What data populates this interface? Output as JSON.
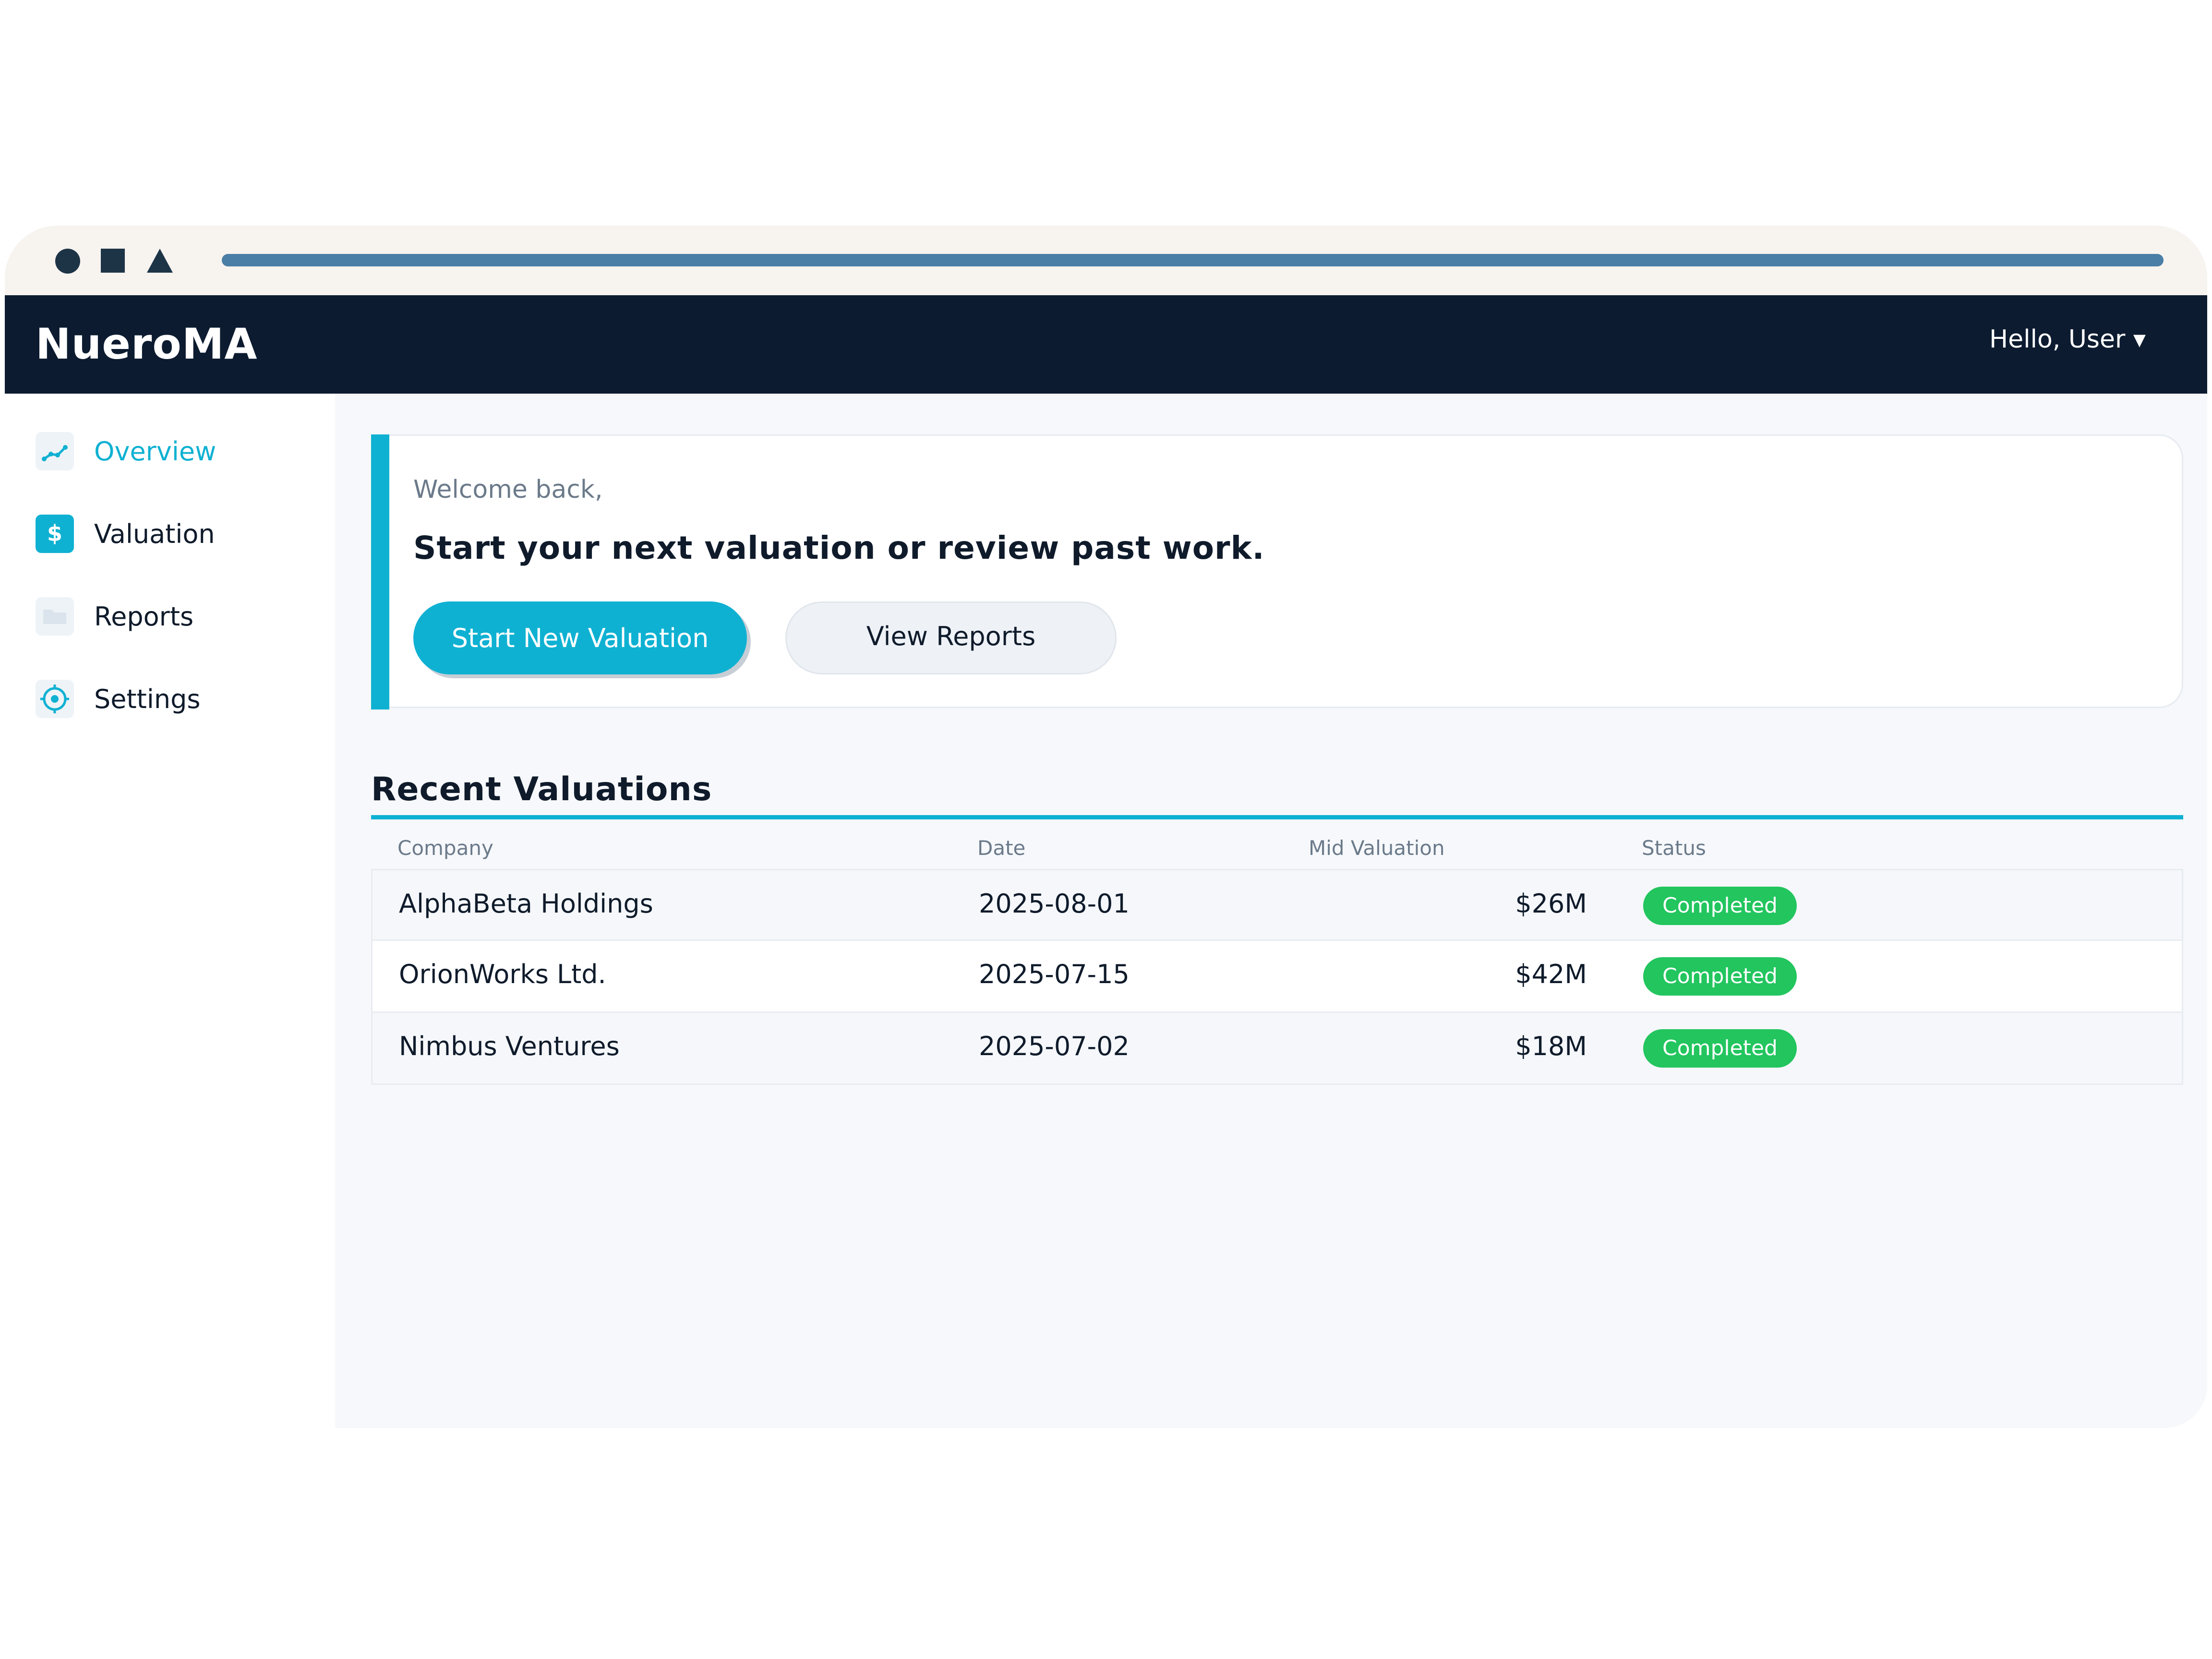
{
  "app": {
    "name": "NueroMA",
    "user_menu": "Hello, User ▾"
  },
  "sidebar": {
    "items": [
      {
        "label": "Overview",
        "icon": "chart-line-icon",
        "active": true
      },
      {
        "label": "Valuation",
        "icon": "dollar-icon",
        "active": false
      },
      {
        "label": "Reports",
        "icon": "folder-icon",
        "active": false
      },
      {
        "label": "Settings",
        "icon": "gear-icon",
        "active": false
      }
    ]
  },
  "hero": {
    "welcome": "Welcome back,",
    "headline": "Start your next valuation or review past work.",
    "primary_button": "Start New Valuation",
    "secondary_button": "View Reports"
  },
  "recent": {
    "title": "Recent Valuations",
    "columns": [
      "Company",
      "Date",
      "Mid Valuation",
      "Status"
    ],
    "rows": [
      {
        "company": "AlphaBeta Holdings",
        "date": "2025-08-01",
        "mid_valuation": "$26M",
        "status": "Completed"
      },
      {
        "company": "OrionWorks Ltd.",
        "date": "2025-07-15",
        "mid_valuation": "$42M",
        "status": "Completed"
      },
      {
        "company": "Nimbus Ventures",
        "date": "2025-07-02",
        "mid_valuation": "$18M",
        "status": "Completed"
      }
    ]
  },
  "colors": {
    "accent": "#0fb1d2",
    "appbar": "#0c1b30",
    "status_completed": "#22c55e"
  }
}
